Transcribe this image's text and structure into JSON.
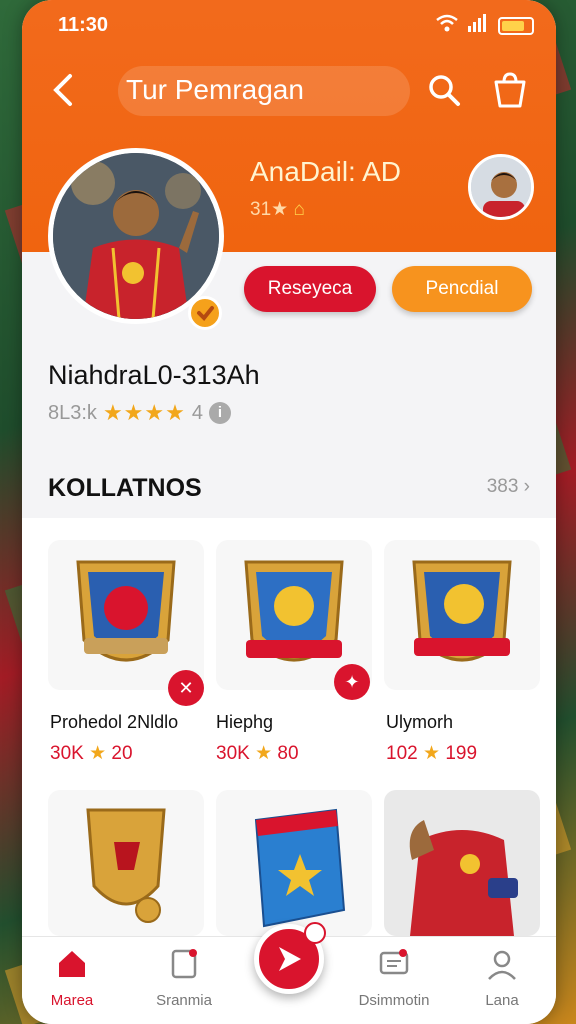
{
  "status_bar": {
    "time": "11:30"
  },
  "header": {
    "title": "Tur Pemragan",
    "profile_name": "AnaDail: AD",
    "profile_meta": "31★"
  },
  "actions": {
    "primary_label": "Reseyeca",
    "secondary_label": "Pencdial"
  },
  "user": {
    "username": "NiahdraL0-313Ah",
    "rating_text": "8L3:k",
    "rating_extra": "4",
    "stars": "★★★★"
  },
  "collections": {
    "title": "KOLLATNOS",
    "see_all": "383",
    "items": [
      {
        "name": "Prohedol 2Nldlo",
        "price": "30K",
        "qty": "20"
      },
      {
        "name": "Hiephg",
        "price": "30K",
        "qty": "80"
      },
      {
        "name": "Ulymorh",
        "price": "102",
        "qty": "199"
      }
    ]
  },
  "tabbar": {
    "items": [
      {
        "label": "Marea"
      },
      {
        "label": "Sranmia"
      },
      {
        "label": "Dsimmotin"
      },
      {
        "label": "Lana"
      }
    ]
  },
  "colors": {
    "accent": "#d9142d",
    "header": "#f26a1c",
    "gold": "#f2a71b"
  }
}
